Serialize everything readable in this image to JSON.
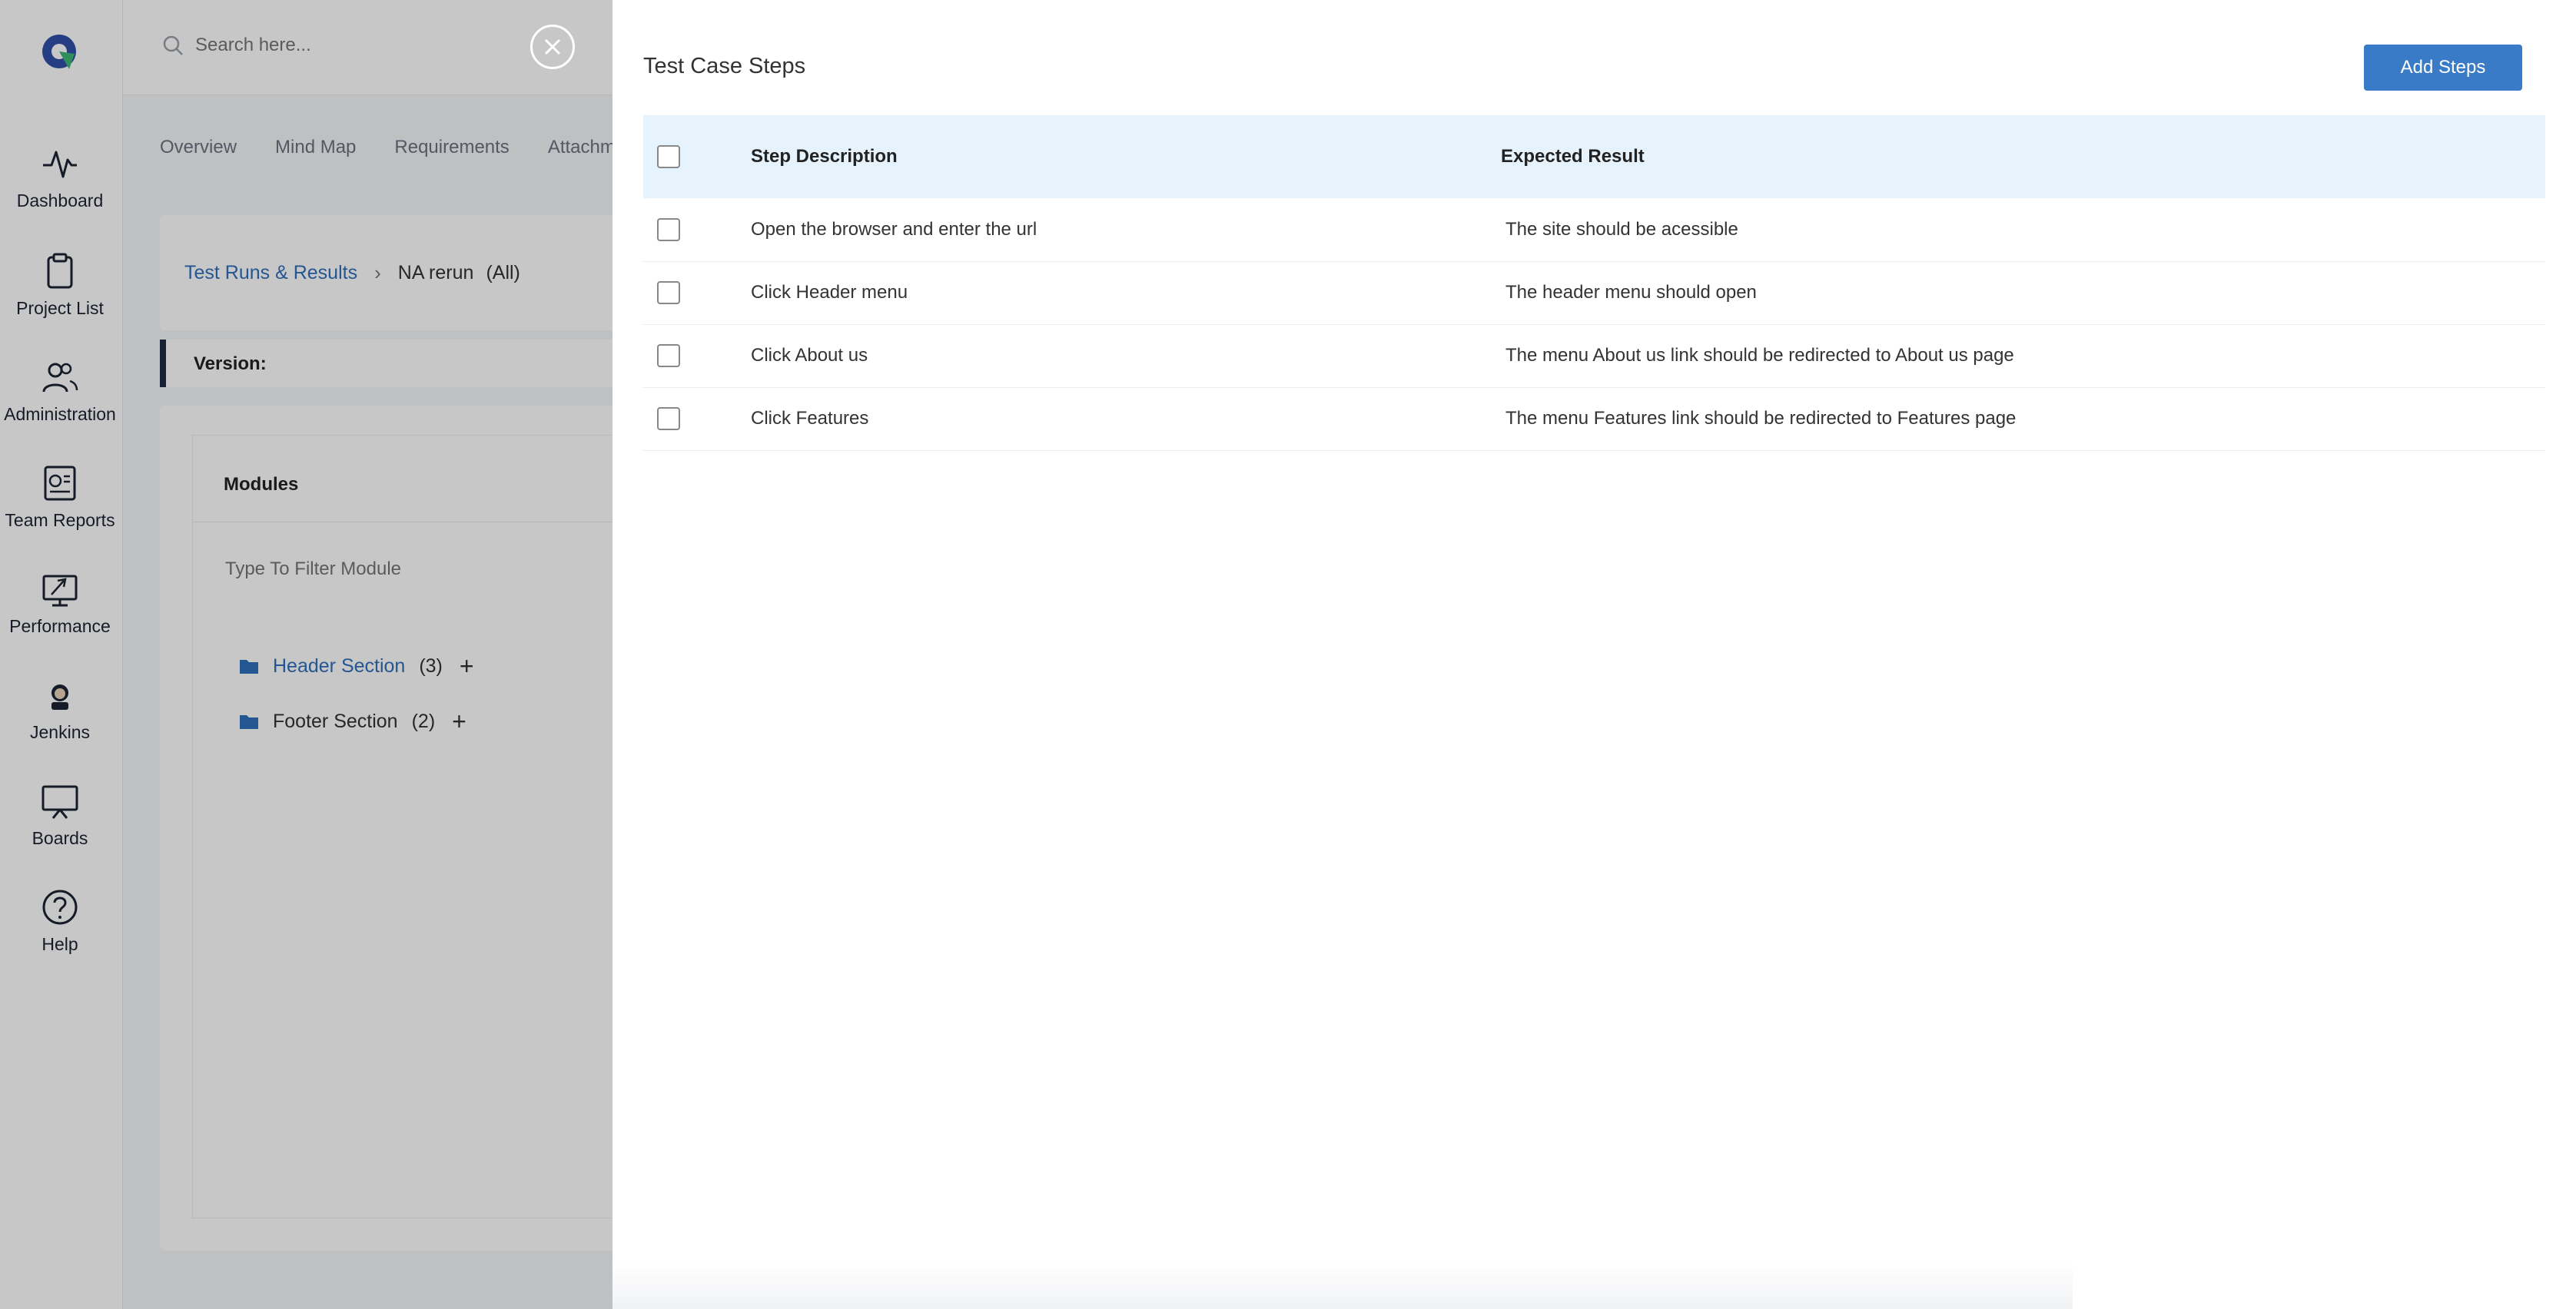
{
  "sidebar": {
    "items": [
      {
        "label": "Dashboard",
        "icon": "pulse-icon"
      },
      {
        "label": "Project List",
        "icon": "clipboard-icon"
      },
      {
        "label": "Administration",
        "icon": "users-icon"
      },
      {
        "label": "Team Reports",
        "icon": "report-icon"
      },
      {
        "label": "Performance",
        "icon": "performance-icon"
      },
      {
        "label": "Jenkins",
        "icon": "jenkins-icon"
      },
      {
        "label": "Boards",
        "icon": "board-icon"
      },
      {
        "label": "Help",
        "icon": "help-icon"
      }
    ]
  },
  "search": {
    "placeholder": "Search here..."
  },
  "tabs": [
    "Overview",
    "Mind Map",
    "Requirements",
    "Attachm"
  ],
  "breadcrumb": {
    "link": "Test Runs & Results",
    "current": "NA rerun",
    "filter": "(All)"
  },
  "version": {
    "label": "Version:"
  },
  "modules": {
    "title": "Modules",
    "filter_placeholder": "Type To Filter Module",
    "items": [
      {
        "name": "Header Section",
        "count": "(3)"
      },
      {
        "name": "Footer Section",
        "count": "(2)"
      }
    ]
  },
  "drawer": {
    "title": "Test Case Steps",
    "add_button": "Add Steps",
    "columns": {
      "description": "Step Description",
      "expected": "Expected Result"
    },
    "rows": [
      {
        "description": "Open the browser and enter the url",
        "expected": "The site should be acessible"
      },
      {
        "description": "Click Header menu",
        "expected": "The header menu should open"
      },
      {
        "description": "Click About us",
        "expected": "The menu About us link should be redirected to About us page"
      },
      {
        "description": "Click Features",
        "expected": "The menu Features link should be redirected to Features page"
      }
    ]
  },
  "colors": {
    "accent": "#3a7bc8",
    "link": "#2f6fba",
    "header_row": "#e6f3fd",
    "nav_dark": "#1e2b44"
  }
}
